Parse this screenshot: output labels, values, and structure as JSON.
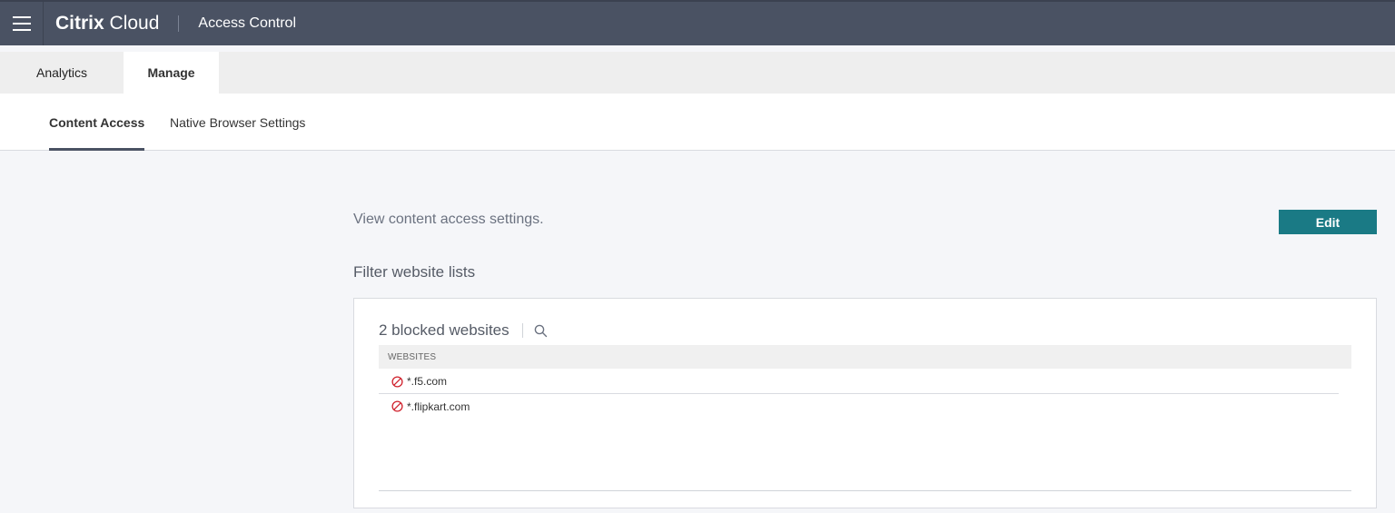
{
  "header": {
    "brand_bold": "Citrix",
    "brand_light": "Cloud",
    "app_title": "Access Control"
  },
  "tabs": [
    {
      "label": "Analytics",
      "active": false
    },
    {
      "label": "Manage",
      "active": true
    }
  ],
  "subtabs": [
    {
      "label": "Content Access",
      "active": true
    },
    {
      "label": "Native Browser Settings",
      "active": false
    }
  ],
  "main": {
    "description": "View content access settings.",
    "edit_label": "Edit",
    "section_title": "Filter website lists"
  },
  "blocked_list": {
    "count_label": "2 blocked websites",
    "column_header": "WEBSITES",
    "rows": [
      {
        "site": "*.f5.com",
        "icon": "blocked-icon"
      },
      {
        "site": "*.flipkart.com",
        "icon": "blocked-icon"
      }
    ]
  },
  "colors": {
    "header_bg": "#4a5263",
    "accent": "#1a7a85",
    "blocked": "#d0212c"
  }
}
